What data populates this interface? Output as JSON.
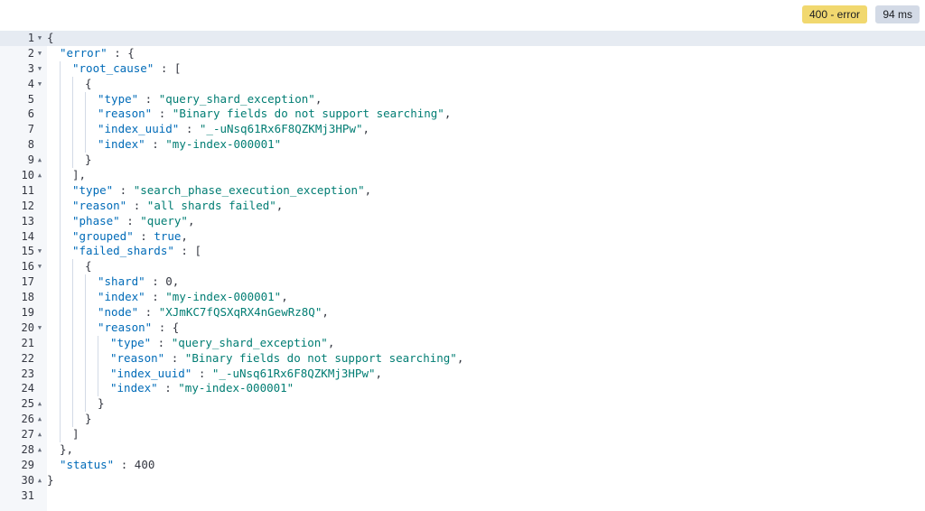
{
  "response_status": {
    "status_badge": "400 - error",
    "time_badge": "94 ms"
  },
  "lines": [
    {
      "num": "1",
      "fold": "open",
      "depth": 0,
      "tokens": [
        [
          "p",
          "{"
        ]
      ]
    },
    {
      "num": "2",
      "fold": "open",
      "depth": 1,
      "tokens": [
        [
          "k",
          "\"error\""
        ],
        [
          "p",
          " : {"
        ]
      ]
    },
    {
      "num": "3",
      "fold": "open",
      "depth": 2,
      "tokens": [
        [
          "k",
          "\"root_cause\""
        ],
        [
          "p",
          " : ["
        ]
      ]
    },
    {
      "num": "4",
      "fold": "open",
      "depth": 3,
      "tokens": [
        [
          "p",
          "{"
        ]
      ]
    },
    {
      "num": "5",
      "fold": "",
      "depth": 4,
      "tokens": [
        [
          "k",
          "\"type\""
        ],
        [
          "p",
          " : "
        ],
        [
          "s",
          "\"query_shard_exception\""
        ],
        [
          "p",
          ","
        ]
      ]
    },
    {
      "num": "6",
      "fold": "",
      "depth": 4,
      "tokens": [
        [
          "k",
          "\"reason\""
        ],
        [
          "p",
          " : "
        ],
        [
          "s",
          "\"Binary fields do not support searching\""
        ],
        [
          "p",
          ","
        ]
      ]
    },
    {
      "num": "7",
      "fold": "",
      "depth": 4,
      "tokens": [
        [
          "k",
          "\"index_uuid\""
        ],
        [
          "p",
          " : "
        ],
        [
          "s",
          "\"_-uNsq61Rx6F8QZKMj3HPw\""
        ],
        [
          "p",
          ","
        ]
      ]
    },
    {
      "num": "8",
      "fold": "",
      "depth": 4,
      "tokens": [
        [
          "k",
          "\"index\""
        ],
        [
          "p",
          " : "
        ],
        [
          "s",
          "\"my-index-000001\""
        ]
      ]
    },
    {
      "num": "9",
      "fold": "close",
      "depth": 3,
      "tokens": [
        [
          "p",
          "}"
        ]
      ]
    },
    {
      "num": "10",
      "fold": "close",
      "depth": 2,
      "tokens": [
        [
          "p",
          "],"
        ]
      ]
    },
    {
      "num": "11",
      "fold": "",
      "depth": 2,
      "tokens": [
        [
          "k",
          "\"type\""
        ],
        [
          "p",
          " : "
        ],
        [
          "s",
          "\"search_phase_execution_exception\""
        ],
        [
          "p",
          ","
        ]
      ]
    },
    {
      "num": "12",
      "fold": "",
      "depth": 2,
      "tokens": [
        [
          "k",
          "\"reason\""
        ],
        [
          "p",
          " : "
        ],
        [
          "s",
          "\"all shards failed\""
        ],
        [
          "p",
          ","
        ]
      ]
    },
    {
      "num": "13",
      "fold": "",
      "depth": 2,
      "tokens": [
        [
          "k",
          "\"phase\""
        ],
        [
          "p",
          " : "
        ],
        [
          "s",
          "\"query\""
        ],
        [
          "p",
          ","
        ]
      ]
    },
    {
      "num": "14",
      "fold": "",
      "depth": 2,
      "tokens": [
        [
          "k",
          "\"grouped\""
        ],
        [
          "p",
          " : "
        ],
        [
          "b",
          "true"
        ],
        [
          "p",
          ","
        ]
      ]
    },
    {
      "num": "15",
      "fold": "open",
      "depth": 2,
      "tokens": [
        [
          "k",
          "\"failed_shards\""
        ],
        [
          "p",
          " : ["
        ]
      ]
    },
    {
      "num": "16",
      "fold": "open",
      "depth": 3,
      "tokens": [
        [
          "p",
          "{"
        ]
      ]
    },
    {
      "num": "17",
      "fold": "",
      "depth": 4,
      "tokens": [
        [
          "k",
          "\"shard\""
        ],
        [
          "p",
          " : "
        ],
        [
          "n",
          "0"
        ],
        [
          "p",
          ","
        ]
      ]
    },
    {
      "num": "18",
      "fold": "",
      "depth": 4,
      "tokens": [
        [
          "k",
          "\"index\""
        ],
        [
          "p",
          " : "
        ],
        [
          "s",
          "\"my-index-000001\""
        ],
        [
          "p",
          ","
        ]
      ]
    },
    {
      "num": "19",
      "fold": "",
      "depth": 4,
      "tokens": [
        [
          "k",
          "\"node\""
        ],
        [
          "p",
          " : "
        ],
        [
          "s",
          "\"XJmKC7fQSXqRX4nGewRz8Q\""
        ],
        [
          "p",
          ","
        ]
      ]
    },
    {
      "num": "20",
      "fold": "open",
      "depth": 4,
      "tokens": [
        [
          "k",
          "\"reason\""
        ],
        [
          "p",
          " : {"
        ]
      ]
    },
    {
      "num": "21",
      "fold": "",
      "depth": 5,
      "tokens": [
        [
          "k",
          "\"type\""
        ],
        [
          "p",
          " : "
        ],
        [
          "s",
          "\"query_shard_exception\""
        ],
        [
          "p",
          ","
        ]
      ]
    },
    {
      "num": "22",
      "fold": "",
      "depth": 5,
      "tokens": [
        [
          "k",
          "\"reason\""
        ],
        [
          "p",
          " : "
        ],
        [
          "s",
          "\"Binary fields do not support searching\""
        ],
        [
          "p",
          ","
        ]
      ]
    },
    {
      "num": "23",
      "fold": "",
      "depth": 5,
      "tokens": [
        [
          "k",
          "\"index_uuid\""
        ],
        [
          "p",
          " : "
        ],
        [
          "s",
          "\"_-uNsq61Rx6F8QZKMj3HPw\""
        ],
        [
          "p",
          ","
        ]
      ]
    },
    {
      "num": "24",
      "fold": "",
      "depth": 5,
      "tokens": [
        [
          "k",
          "\"index\""
        ],
        [
          "p",
          " : "
        ],
        [
          "s",
          "\"my-index-000001\""
        ]
      ]
    },
    {
      "num": "25",
      "fold": "close",
      "depth": 4,
      "tokens": [
        [
          "p",
          "}"
        ]
      ]
    },
    {
      "num": "26",
      "fold": "close",
      "depth": 3,
      "tokens": [
        [
          "p",
          "}"
        ]
      ]
    },
    {
      "num": "27",
      "fold": "close",
      "depth": 2,
      "tokens": [
        [
          "p",
          "]"
        ]
      ]
    },
    {
      "num": "28",
      "fold": "close",
      "depth": 1,
      "tokens": [
        [
          "p",
          "},"
        ]
      ]
    },
    {
      "num": "29",
      "fold": "",
      "depth": 1,
      "tokens": [
        [
          "k",
          "\"status\""
        ],
        [
          "p",
          " : "
        ],
        [
          "n",
          "400"
        ]
      ]
    },
    {
      "num": "30",
      "fold": "close",
      "depth": 0,
      "tokens": [
        [
          "p",
          "}"
        ]
      ]
    },
    {
      "num": "31",
      "fold": "",
      "depth": 0,
      "tokens": []
    }
  ],
  "active_line": "1",
  "fold_icons": {
    "open": "caret-down-icon",
    "close": "caret-up-icon"
  },
  "colors": {
    "key": "#006bb8",
    "string": "#017d73",
    "status_badge": "#f1d86f",
    "time_badge": "#d3dae6"
  }
}
